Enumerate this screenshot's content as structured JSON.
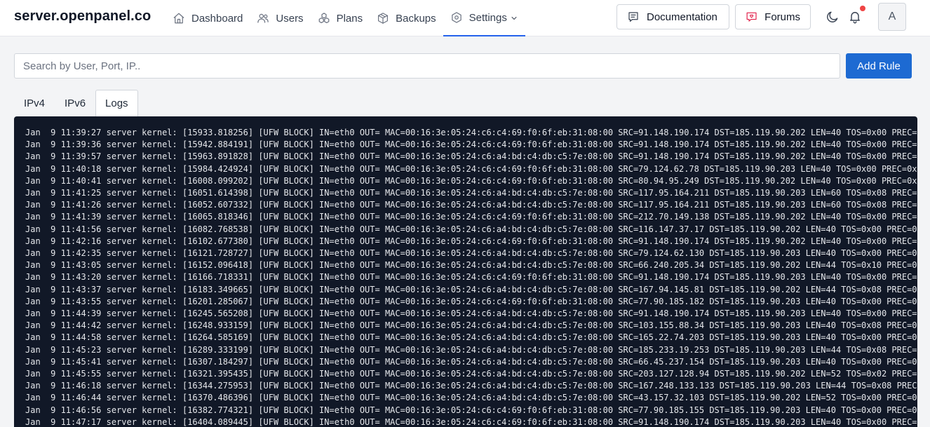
{
  "header": {
    "brand": "server.openpanel.co",
    "nav": [
      {
        "label": "Dashboard",
        "icon": "home-icon"
      },
      {
        "label": "Users",
        "icon": "users-icon"
      },
      {
        "label": "Plans",
        "icon": "plans-icon"
      },
      {
        "label": "Backups",
        "icon": "box-icon"
      },
      {
        "label": "Settings",
        "icon": "settings-icon",
        "active": true,
        "dropdown": true
      }
    ],
    "documentation_label": "Documentation",
    "forums_label": "Forums",
    "avatar_initial": "A",
    "notification_dot": true,
    "colors": {
      "accent": "#2563eb",
      "forums_icon": "#e11d48",
      "notification": "#ef4444"
    }
  },
  "toolbar": {
    "search_placeholder": "Search by User, Port, IP..",
    "search_value": "",
    "add_rule_label": "Add Rule",
    "add_rule_color": "#1d6ad2"
  },
  "tabs": [
    {
      "label": "IPv4",
      "active": false
    },
    {
      "label": "IPv6",
      "active": false
    },
    {
      "label": "Logs",
      "active": true
    }
  ],
  "logs": [
    "Jan  9 11:39:27 server kernel: [15933.818256] [UFW BLOCK] IN=eth0 OUT= MAC=00:16:3e:05:24:c6:c4:69:f0:6f:eb:31:08:00 SRC=91.148.190.174 DST=185.119.90.202 LEN=40 TOS=0x00 PREC=0",
    "Jan  9 11:39:36 server kernel: [15942.884191] [UFW BLOCK] IN=eth0 OUT= MAC=00:16:3e:05:24:c6:c4:69:f0:6f:eb:31:08:00 SRC=91.148.190.174 DST=185.119.90.202 LEN=40 TOS=0x00 PREC=0",
    "Jan  9 11:39:57 server kernel: [15963.891828] [UFW BLOCK] IN=eth0 OUT= MAC=00:16:3e:05:24:c6:a4:bd:c4:db:c5:7e:08:00 SRC=91.148.190.174 DST=185.119.90.202 LEN=40 TOS=0x00 PREC=0",
    "Jan  9 11:40:18 server kernel: [15984.424924] [UFW BLOCK] IN=eth0 OUT= MAC=00:16:3e:05:24:c6:c4:69:f0:6f:eb:31:08:00 SRC=79.124.62.78 DST=185.119.90.203 LEN=40 TOS=0x00 PREC=0x0",
    "Jan  9 11:40:41 server kernel: [16008.099202] [UFW BLOCK] IN=eth0 OUT= MAC=00:16:3e:05:24:c6:c4:69:f0:6f:eb:31:08:00 SRC=80.94.95.249 DST=185.119.90.202 LEN=40 TOS=0x00 PREC=0x0",
    "Jan  9 11:41:25 server kernel: [16051.614398] [UFW BLOCK] IN=eth0 OUT= MAC=00:16:3e:05:24:c6:a4:bd:c4:db:c5:7e:08:00 SRC=117.95.164.211 DST=185.119.90.203 LEN=60 TOS=0x08 PREC=0",
    "Jan  9 11:41:26 server kernel: [16052.607332] [UFW BLOCK] IN=eth0 OUT= MAC=00:16:3e:05:24:c6:a4:bd:c4:db:c5:7e:08:00 SRC=117.95.164.211 DST=185.119.90.203 LEN=60 TOS=0x08 PREC=0",
    "Jan  9 11:41:39 server kernel: [16065.818346] [UFW BLOCK] IN=eth0 OUT= MAC=00:16:3e:05:24:c6:c4:69:f0:6f:eb:31:08:00 SRC=212.70.149.138 DST=185.119.90.202 LEN=40 TOS=0x00 PREC=0",
    "Jan  9 11:41:56 server kernel: [16082.768538] [UFW BLOCK] IN=eth0 OUT= MAC=00:16:3e:05:24:c6:a4:bd:c4:db:c5:7e:08:00 SRC=116.147.37.17 DST=185.119.90.202 LEN=40 TOS=0x00 PREC=0x",
    "Jan  9 11:42:16 server kernel: [16102.677380] [UFW BLOCK] IN=eth0 OUT= MAC=00:16:3e:05:24:c6:c4:69:f0:6f:eb:31:08:00 SRC=91.148.190.174 DST=185.119.90.202 LEN=40 TOS=0x00 PREC=0",
    "Jan  9 11:42:35 server kernel: [16121.728727] [UFW BLOCK] IN=eth0 OUT= MAC=00:16:3e:05:24:c6:a4:bd:c4:db:c5:7e:08:00 SRC=79.124.62.130 DST=185.119.90.203 LEN=40 TOS=0x00 PREC=0x",
    "Jan  9 11:43:05 server kernel: [16152.096418] [UFW BLOCK] IN=eth0 OUT= MAC=00:16:3e:05:24:c6:a4:bd:c4:db:c5:7e:08:00 SRC=66.240.205.34 DST=185.119.90.202 LEN=44 TOS=0x10 PREC=0x",
    "Jan  9 11:43:20 server kernel: [16166.718331] [UFW BLOCK] IN=eth0 OUT= MAC=00:16:3e:05:24:c6:c4:69:f0:6f:eb:31:08:00 SRC=91.148.190.174 DST=185.119.90.203 LEN=40 TOS=0x00 PREC=0",
    "Jan  9 11:43:37 server kernel: [16183.349665] [UFW BLOCK] IN=eth0 OUT= MAC=00:16:3e:05:24:c6:a4:bd:c4:db:c5:7e:08:00 SRC=167.94.145.81 DST=185.119.90.202 LEN=44 TOS=0x08 PREC=0x",
    "Jan  9 11:43:55 server kernel: [16201.285067] [UFW BLOCK] IN=eth0 OUT= MAC=00:16:3e:05:24:c6:c4:69:f0:6f:eb:31:08:00 SRC=77.90.185.182 DST=185.119.90.203 LEN=40 TOS=0x00 PREC=0x",
    "Jan  9 11:44:39 server kernel: [16245.565208] [UFW BLOCK] IN=eth0 OUT= MAC=00:16:3e:05:24:c6:a4:bd:c4:db:c5:7e:08:00 SRC=91.148.190.174 DST=185.119.90.203 LEN=40 TOS=0x00 PREC=0",
    "Jan  9 11:44:42 server kernel: [16248.933159] [UFW BLOCK] IN=eth0 OUT= MAC=00:16:3e:05:24:c6:a4:bd:c4:db:c5:7e:08:00 SRC=103.155.88.34 DST=185.119.90.203 LEN=40 TOS=0x08 PREC=0x",
    "Jan  9 11:44:58 server kernel: [16264.585169] [UFW BLOCK] IN=eth0 OUT= MAC=00:16:3e:05:24:c6:a4:bd:c4:db:c5:7e:08:00 SRC=165.22.74.203 DST=185.119.90.203 LEN=40 TOS=0x00 PREC=0x",
    "Jan  9 11:45:23 server kernel: [16289.333199] [UFW BLOCK] IN=eth0 OUT= MAC=00:16:3e:05:24:c6:a4:bd:c4:db:c5:7e:08:00 SRC=185.233.19.253 DST=185.119.90.203 LEN=44 TOS=0x08 PREC=0",
    "Jan  9 11:45:41 server kernel: [16307.184297] [UFW BLOCK] IN=eth0 OUT= MAC=00:16:3e:05:24:c6:a4:bd:c4:db:c5:7e:08:00 SRC=66.45.237.154 DST=185.119.90.203 LEN=40 TOS=0x00 PREC=0x",
    "Jan  9 11:45:55 server kernel: [16321.395435] [UFW BLOCK] IN=eth0 OUT= MAC=00:16:3e:05:24:c6:a4:bd:c4:db:c5:7e:08:00 SRC=203.127.128.94 DST=185.119.90.202 LEN=52 TOS=0x02 PREC=0",
    "Jan  9 11:46:18 server kernel: [16344.275953] [UFW BLOCK] IN=eth0 OUT= MAC=00:16:3e:05:24:c6:a4:bd:c4:db:c5:7e:08:00 SRC=167.248.133.133 DST=185.119.90.203 LEN=44 TOS=0x08 PREC=",
    "Jan  9 11:46:44 server kernel: [16370.486396] [UFW BLOCK] IN=eth0 OUT= MAC=00:16:3e:05:24:c6:a4:bd:c4:db:c5:7e:08:00 SRC=43.157.32.103 DST=185.119.90.202 LEN=52 TOS=0x00 PREC=0x",
    "Jan  9 11:46:56 server kernel: [16382.774321] [UFW BLOCK] IN=eth0 OUT= MAC=00:16:3e:05:24:c6:c4:69:f0:6f:eb:31:08:00 SRC=77.90.185.155 DST=185.119.90.203 LEN=40 TOS=0x00 PREC=0x",
    "Jan  9 11:47:17 server kernel: [16404.089445] [UFW BLOCK] IN=eth0 OUT= MAC=00:16:3e:05:24:c6:c4:69:f0:6f:eb:31:08:00 SRC=91.148.190.174 DST=185.119.90.203 LEN=40 TOS=0x00 PREC=0"
  ]
}
